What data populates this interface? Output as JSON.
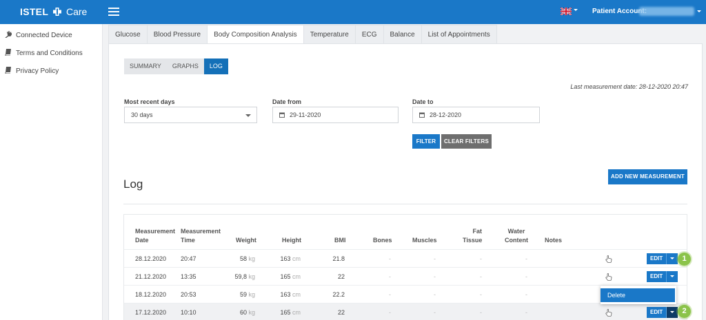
{
  "header": {
    "brand_bold": "ISTEL",
    "brand_light": "Care",
    "patient_label": "Patient Account:",
    "icons": {
      "menu": "hamburger-icon",
      "language": "uk-flag-icon"
    },
    "colors": {
      "primary": "#1a78c8",
      "selected_tab": "#1470b8",
      "marker": "#8bc34a"
    }
  },
  "sidebar": {
    "items": [
      {
        "label": "Connected Device",
        "icon": "plug-icon"
      },
      {
        "label": "Terms and Conditions",
        "icon": "book-icon"
      },
      {
        "label": "Privacy Policy",
        "icon": "book-icon"
      }
    ]
  },
  "tabs": [
    {
      "label": "Glucose"
    },
    {
      "label": "Blood Pressure"
    },
    {
      "label": "Body Composition Analysis",
      "active": true
    },
    {
      "label": "Temperature"
    },
    {
      "label": "ECG"
    },
    {
      "label": "Balance"
    },
    {
      "label": "List of Appointments"
    }
  ],
  "view_tabs": [
    {
      "label": "SUMMARY"
    },
    {
      "label": "GRAPHS"
    },
    {
      "label": "LOG",
      "active": true
    }
  ],
  "last_measurement": "Last measurement date: 28-12-2020 20:47",
  "filters": {
    "recent_label": "Most recent days",
    "recent_value": "30 days",
    "from_label": "Date from",
    "from_value": "29-11-2020",
    "to_label": "Date to",
    "to_value": "28-12-2020",
    "filter_btn": "FILTER",
    "clear_btn": "CLEAR FILTERS"
  },
  "log": {
    "title": "Log",
    "add_btn": "ADD NEW MEASUREMENT",
    "headers": {
      "date_1": "Measurement",
      "date_2": "Date",
      "time_1": "Measurement",
      "time_2": "Time",
      "weight": "Weight",
      "height": "Height",
      "bmi": "BMI",
      "bones": "Bones",
      "muscles": "Muscles",
      "fat_1": "Fat",
      "fat_2": "Tissue",
      "water_1": "Water",
      "water_2": "Content",
      "notes": "Notes"
    },
    "units": {
      "weight": "kg",
      "height": "cm"
    },
    "dash": "-",
    "edit_label": "EDIT",
    "rows": [
      {
        "date": "28.12.2020",
        "time": "20:47",
        "weight": "58",
        "height": "163",
        "bmi": "21.8"
      },
      {
        "date": "21.12.2020",
        "time": "13:35",
        "weight": "59,8",
        "height": "165",
        "bmi": "22"
      },
      {
        "date": "18.12.2020",
        "time": "20:53",
        "weight": "59",
        "height": "163",
        "bmi": "22.2"
      },
      {
        "date": "17.12.2020",
        "time": "10:10",
        "weight": "60",
        "height": "165",
        "bmi": "22"
      }
    ],
    "dropdown_item": "Delete"
  },
  "markers": [
    "1",
    "2"
  ]
}
